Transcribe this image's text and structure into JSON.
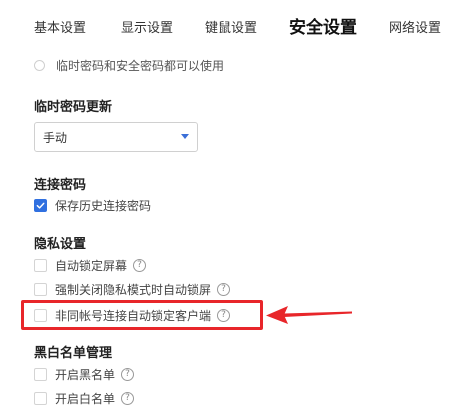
{
  "tabs": [
    {
      "label": "基本设置",
      "active": false
    },
    {
      "label": "显示设置",
      "active": false
    },
    {
      "label": "键鼠设置",
      "active": false
    },
    {
      "label": "安全设置",
      "active": true
    },
    {
      "label": "网络设置",
      "active": false
    }
  ],
  "temp_password_hint": "临时密码和安全密码都可以使用",
  "temp_password_update": {
    "title": "临时密码更新",
    "select_value": "手动"
  },
  "connection_password": {
    "title": "连接密码",
    "save_history_label": "保存历史连接密码",
    "save_history_checked": true
  },
  "privacy": {
    "title": "隐私设置",
    "items": [
      {
        "label": "自动锁定屏幕",
        "checked": false
      },
      {
        "label": "强制关闭隐私模式时自动锁屏",
        "checked": false
      },
      {
        "label": "非同帐号连接自动锁定客户端",
        "checked": false
      }
    ]
  },
  "blackwhite": {
    "title": "黑白名单管理",
    "items": [
      {
        "label": "开启黑名单",
        "checked": false
      },
      {
        "label": "开启白名单",
        "checked": false
      }
    ]
  },
  "help_glyph": "?",
  "colors": {
    "accent": "#3070e0",
    "annotation_red": "#e8262a"
  }
}
